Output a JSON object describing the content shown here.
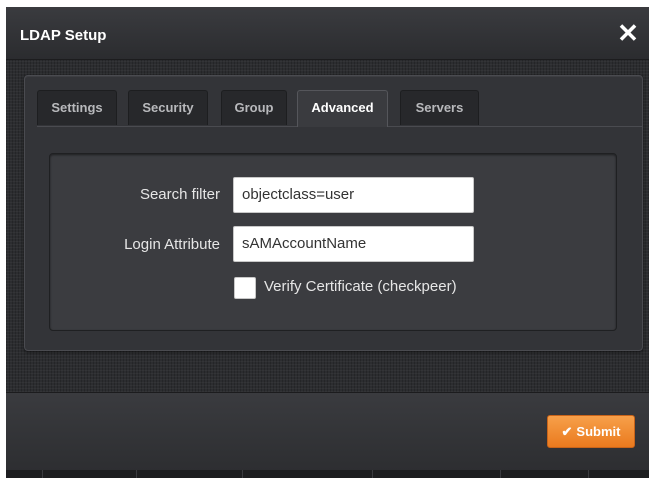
{
  "dialog": {
    "title": "LDAP Setup",
    "close_icon": "close-icon"
  },
  "tabs": [
    {
      "label": "Settings",
      "active": false
    },
    {
      "label": "Security",
      "active": false
    },
    {
      "label": "Group",
      "active": false
    },
    {
      "label": "Advanced",
      "active": true
    },
    {
      "label": "Servers",
      "active": false
    }
  ],
  "form": {
    "search_filter_label": "Search filter",
    "search_filter_value": "objectclass=user",
    "login_attribute_label": "Login Attribute",
    "login_attribute_value": "sAMAccountName",
    "verify_certificate_label": "Verify Certificate (checkpeer)",
    "verify_certificate_checked": false
  },
  "footer": {
    "submit_label": "Submit",
    "submit_icon": "checkmark-icon"
  },
  "colors": {
    "accent": "#f0892f",
    "dialog_bg": "#2f3033",
    "text": "#e6e6e6"
  }
}
